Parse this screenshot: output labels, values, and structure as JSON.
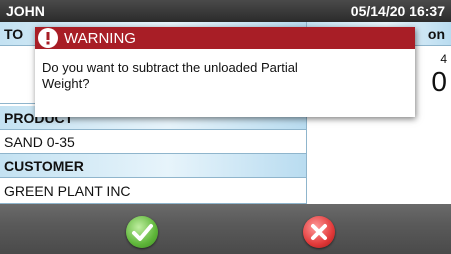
{
  "titlebar": {
    "user": "JOHN",
    "datetime": "05/14/20 16:37"
  },
  "header": {
    "left_label": "TO",
    "right_label": "on"
  },
  "right_panel": {
    "small_value": "4",
    "big_value": "0"
  },
  "fields": {
    "product_label": "PRODUCT",
    "product_value": "SAND 0-35",
    "customer_label": "CUSTOMER",
    "customer_value": "GREEN PLANT INC"
  },
  "dialog": {
    "title": "WARNING",
    "message": "Do you want to subtract the unloaded Partial Weight?",
    "icon": "warning-icon"
  },
  "buttons": {
    "confirm_icon": "checkmark-icon",
    "cancel_icon": "x-icon"
  },
  "colors": {
    "dialog_header": "#a81e26",
    "confirm": "#5fb63a",
    "cancel": "#e23a3a",
    "header_gradient": "#c4e2f2"
  }
}
